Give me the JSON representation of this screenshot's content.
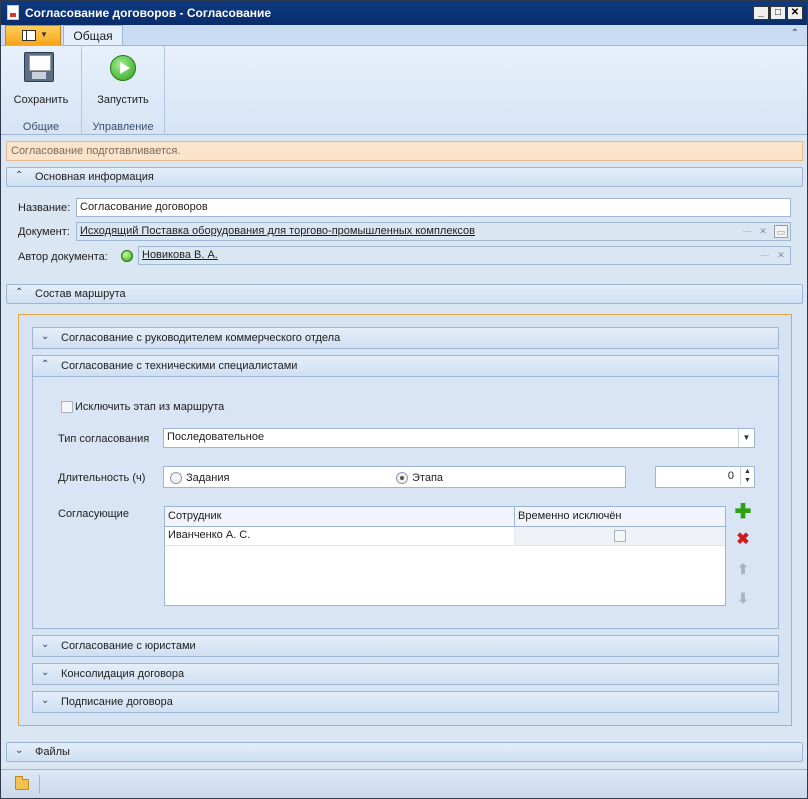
{
  "window": {
    "title": "Согласование договоров - Согласование"
  },
  "ribbon": {
    "tab_general": "Общая",
    "save_label": "Сохранить",
    "run_label": "Запустить",
    "group_common": "Общие",
    "group_control": "Управление"
  },
  "status": {
    "message": "Согласование подготавливается."
  },
  "basic_info": {
    "header": "Основная информация",
    "name_label": "Название:",
    "name_value": "Согласование договоров",
    "document_label": "Документ:",
    "document_value": "Исходящий Поставка оборудования для торгово-промышленных комплексов",
    "author_label": "Автор документа:",
    "author_value": "Новикова В. А."
  },
  "route": {
    "header": "Состав маршрута",
    "stages": [
      {
        "label": "Согласование с руководителем коммерческого отдела"
      },
      {
        "label": "Согласование с техническими специалистами"
      },
      {
        "label": "Согласование с юристами"
      },
      {
        "label": "Консолидация договора"
      },
      {
        "label": "Подписание договора"
      }
    ],
    "expanded": {
      "exclude_label": "Исключить этап из маршрута",
      "type_label": "Тип согласования",
      "type_value": "Последовательное",
      "duration_label": "Длительность (ч)",
      "radio_tasks": "Задания",
      "radio_stage": "Этапа",
      "duration_value": "0",
      "approvers_label": "Согласующие",
      "col_employee": "Сотрудник",
      "col_excluded": "Временно исключён",
      "rows": [
        {
          "employee": "Иванченко А. С."
        }
      ]
    }
  },
  "files": {
    "header": "Файлы"
  },
  "icons": {
    "save": "floppy-disk-icon",
    "run": "play-icon",
    "add": "plus-icon",
    "delete": "x-icon",
    "up": "arrow-up-icon",
    "down": "arrow-down-icon",
    "folder": "folder-icon"
  }
}
